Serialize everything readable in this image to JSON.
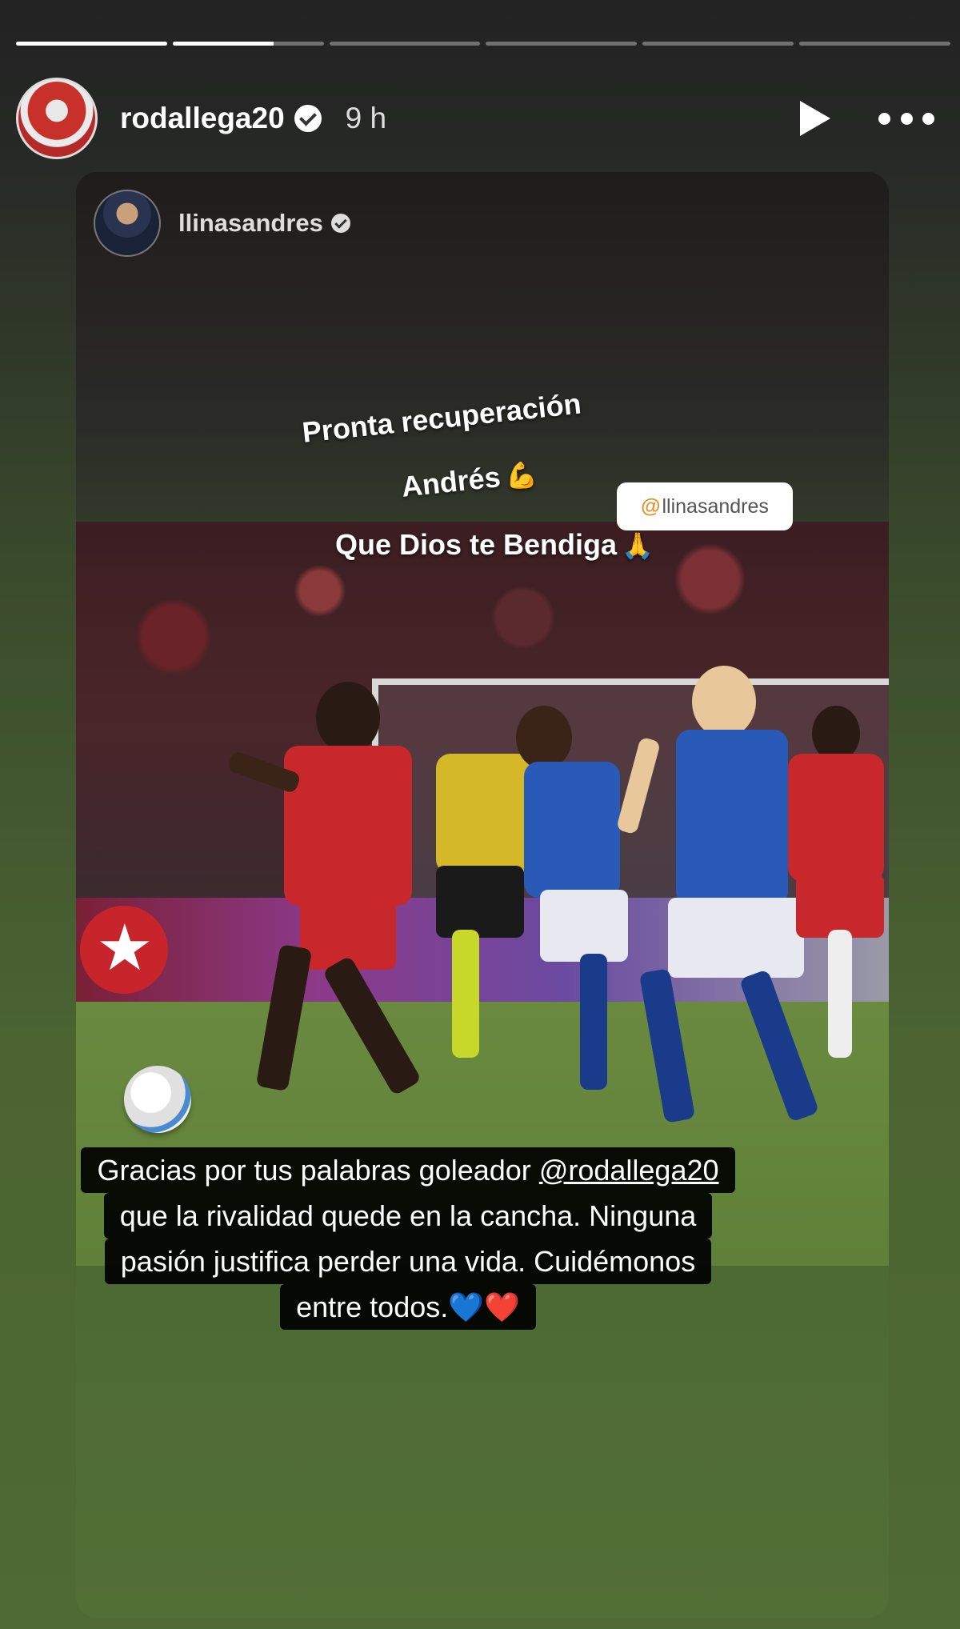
{
  "story": {
    "progress": [
      1.0,
      0.67,
      0.0,
      0.0,
      0.0,
      0.0
    ]
  },
  "header": {
    "username": "rodallega20",
    "time": "9 h"
  },
  "card": {
    "username": "llinasandres",
    "caption_line1": "Pronta recuperación",
    "caption_line2": "Andrés",
    "caption_line3": "Que Dios te Bendiga",
    "mention_sticker": "llinasandres",
    "reply_line1_text": "Gracias por tus palabras goleador",
    "reply_mention": "@rodallega20",
    "reply_line2": "que la rivalidad quede en la cancha. Ninguna",
    "reply_line3": "pasión justifica perder una vida. Cuidémonos",
    "reply_line4": "entre todos."
  },
  "colors": {
    "accent_blue_heart": "#2b8de0",
    "accent_red_heart": "#e8282a"
  }
}
